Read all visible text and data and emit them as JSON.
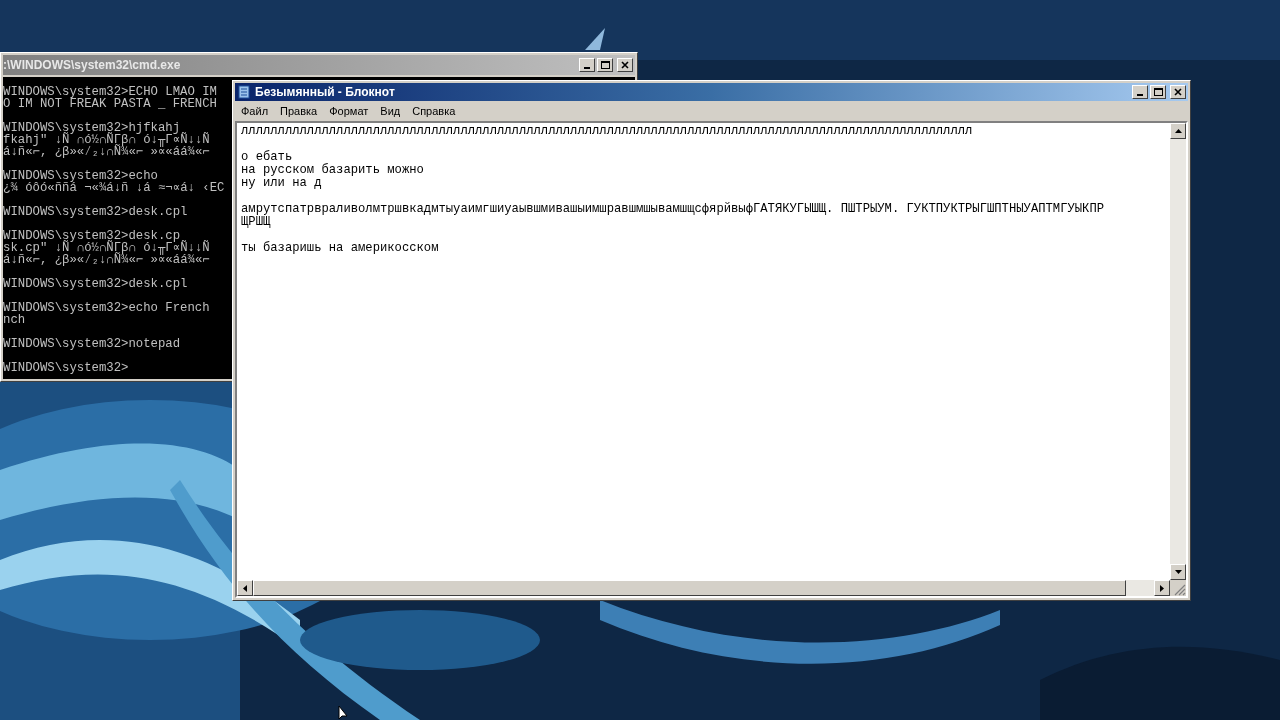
{
  "cmd_window": {
    "title": ":\\WINDOWS\\system32\\cmd.exe",
    "blocks": [
      [
        "WINDOWS\\system32>ECHO LMAO IM",
        "O IM NOT FREAK PASTA _ FRENCH"
      ],
      [
        "WINDOWS\\system32>hjfkahj",
        "fkahj\" ↓Ñ ∩ó½∩ÑΓβ∩ ó↓╥Γ∝Ñ↓↓Ñ",
        "á↓ñ«⌐, ¿β»«⁄₂↓∩Ñ¾«⌐ »∝«áá¾«⌐"
      ],
      [
        "WINDOWS\\system32>echo",
        "¿¾ óôó«ññá ¬«¾á↓ñ ↓á ≈¬∝á↓ ‹EC"
      ],
      [
        "WINDOWS\\system32>desk.cpl"
      ],
      [
        "WINDOWS\\system32>desk.cp",
        "sk.cp\" ↓Ñ ∩ó½∩ÑΓβ∩ ó↓╥Γ∝Ñ↓↓Ñ",
        "á↓ñ«⌐, ¿β»«⁄₂↓∩Ñ¾«⌐ »∝«áá¾«⌐"
      ],
      [
        "WINDOWS\\system32>desk.cpl"
      ],
      [
        "WINDOWS\\system32>echo French",
        "nch"
      ],
      [
        "WINDOWS\\system32>notepad"
      ],
      [
        "WINDOWS\\system32>"
      ]
    ]
  },
  "notepad": {
    "title": "Безымянный - Блокнот",
    "menu": [
      "Файл",
      "Правка",
      "Формат",
      "Вид",
      "Справка"
    ],
    "blocks": [
      [
        "лллллллллллллллллллллллллллллллллллллллллллллллллллллллллллллллллллллллллллллллллллллллллллллллллллл"
      ],
      [
        "о ебать",
        "на русском базарить можно",
        "ну или на д"
      ],
      [
        "амрутспатрвраливолмтршвкадмтыуаимгшиуаывшмивашыимшравшмшывамшщсфярйвыфГАТЯКУГЫШЩ. ПШТРЫУМ. ГУКТПУКТРЫГШПТНЫУАПТМГУЫКПР",
        "ЩРШЩ"
      ],
      [
        "ты базаришь на америкосском"
      ]
    ]
  }
}
